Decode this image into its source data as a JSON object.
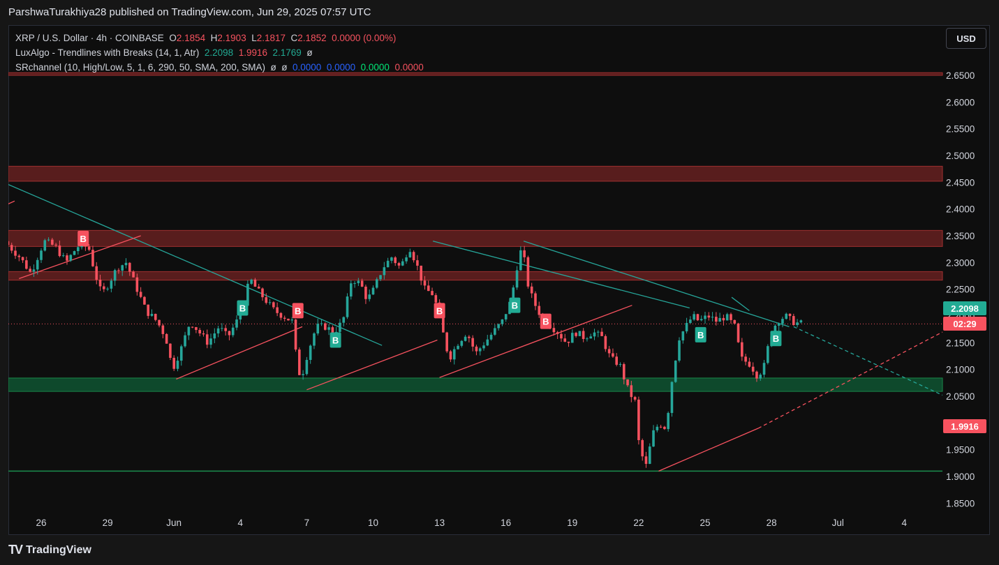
{
  "header": {
    "published_line": "ParshwaTurakhiya28 published on TradingView.com, Jun 29, 2025 07:57 UTC"
  },
  "legend": {
    "symbol_line": "XRP / U.S. Dollar · 4h · COINBASE",
    "ohlc": {
      "o_label": "O",
      "o_value": "2.1854",
      "h_label": "H",
      "h_value": "2.1903",
      "l_label": "L",
      "l_value": "2.1817",
      "c_label": "C",
      "c_value": "2.1852",
      "change": "0.0000 (0.00%)"
    },
    "luxalgo_name": "LuxAlgo - Trendlines with Breaks (14, 1, Atr)",
    "luxalgo_values": [
      "2.2098",
      "1.9916",
      "2.1769",
      "ø"
    ],
    "srchannel_name": "SRchannel (10, High/Low, 5, 1, 6, 290, 50, SMA, 200, SMA)",
    "srchannel_values": [
      "ø",
      "ø",
      "0.0000",
      "0.0000",
      "0.0000",
      "0.0000"
    ]
  },
  "toolbar": {
    "currency": "USD"
  },
  "price_tags": {
    "upper_value": "2.2098",
    "countdown": "02:29",
    "lower_value": "1.9916"
  },
  "footer": {
    "logo_icon": "tradingview-logo-icon",
    "brand": "TradingView"
  },
  "colors": {
    "up": "#26a69a",
    "down": "#f7525f",
    "teal_tag": "#22ab94",
    "resistance_zone": "#5c1e1e",
    "support_zone": "#0f4d2e",
    "frame_bg": "#0e0e0e"
  },
  "chart_data": {
    "type": "candlestick",
    "symbol": "XRP / U.S. Dollar",
    "timeframe": "4h",
    "ylim": [
      1.83,
      2.68
    ],
    "y_ticks": [
      "2.6500",
      "2.6000",
      "2.5500",
      "2.5000",
      "2.4500",
      "2.4000",
      "2.3500",
      "2.3000",
      "2.2500",
      "2.2000",
      "2.1500",
      "2.1000",
      "2.0500",
      "2.0000",
      "1.9500",
      "1.9000",
      "1.8500"
    ],
    "x_ticks": [
      "26",
      "29",
      "Jun",
      "4",
      "7",
      "10",
      "13",
      "16",
      "19",
      "22",
      "25",
      "28",
      "Jul",
      "4"
    ],
    "x_tick_days": [
      26,
      29,
      32,
      35,
      38,
      41,
      44,
      47,
      50,
      53,
      56,
      59,
      62,
      65
    ],
    "x_tick_days_note": "continuous day count starting May 1, 2025",
    "price_path": [
      [
        24.5,
        2.34
      ],
      [
        25.2,
        2.31
      ],
      [
        25.7,
        2.28
      ],
      [
        26.3,
        2.34
      ],
      [
        26.8,
        2.33
      ],
      [
        27.3,
        2.3
      ],
      [
        27.8,
        2.33
      ],
      [
        28.3,
        2.33
      ],
      [
        28.6,
        2.28
      ],
      [
        28.9,
        2.24
      ],
      [
        29.2,
        2.26
      ],
      [
        29.6,
        2.29
      ],
      [
        30.0,
        2.3
      ],
      [
        30.4,
        2.26
      ],
      [
        30.9,
        2.21
      ],
      [
        31.4,
        2.19
      ],
      [
        31.8,
        2.16
      ],
      [
        32.1,
        2.1
      ],
      [
        32.5,
        2.14
      ],
      [
        32.9,
        2.19
      ],
      [
        33.3,
        2.17
      ],
      [
        33.7,
        2.15
      ],
      [
        34.2,
        2.18
      ],
      [
        34.6,
        2.16
      ],
      [
        35.0,
        2.19
      ],
      [
        35.3,
        2.22
      ],
      [
        35.6,
        2.27
      ],
      [
        35.9,
        2.25
      ],
      [
        36.3,
        2.23
      ],
      [
        36.7,
        2.21
      ],
      [
        37.1,
        2.2
      ],
      [
        37.5,
        2.19
      ],
      [
        37.7,
        2.12
      ],
      [
        37.9,
        2.08
      ],
      [
        38.2,
        2.13
      ],
      [
        38.6,
        2.18
      ],
      [
        39.0,
        2.18
      ],
      [
        39.4,
        2.17
      ],
      [
        39.8,
        2.19
      ],
      [
        40.2,
        2.27
      ],
      [
        40.6,
        2.26
      ],
      [
        40.9,
        2.23
      ],
      [
        41.2,
        2.25
      ],
      [
        41.6,
        2.29
      ],
      [
        42.0,
        2.31
      ],
      [
        42.4,
        2.29
      ],
      [
        42.8,
        2.33
      ],
      [
        43.1,
        2.3
      ],
      [
        43.5,
        2.25
      ],
      [
        43.9,
        2.24
      ],
      [
        44.2,
        2.19
      ],
      [
        44.6,
        2.12
      ],
      [
        45.0,
        2.15
      ],
      [
        45.4,
        2.17
      ],
      [
        45.8,
        2.13
      ],
      [
        46.2,
        2.15
      ],
      [
        46.6,
        2.17
      ],
      [
        47.0,
        2.19
      ],
      [
        47.4,
        2.23
      ],
      [
        47.7,
        2.3
      ],
      [
        47.9,
        2.33
      ],
      [
        48.2,
        2.25
      ],
      [
        48.6,
        2.21
      ],
      [
        49.0,
        2.19
      ],
      [
        49.5,
        2.17
      ],
      [
        49.9,
        2.15
      ],
      [
        50.3,
        2.17
      ],
      [
        50.7,
        2.16
      ],
      [
        51.1,
        2.17
      ],
      [
        51.5,
        2.16
      ],
      [
        51.9,
        2.12
      ],
      [
        52.3,
        2.11
      ],
      [
        52.7,
        2.06
      ],
      [
        53.0,
        2.04
      ],
      [
        53.2,
        1.95
      ],
      [
        53.5,
        1.92
      ],
      [
        53.8,
        1.98
      ],
      [
        54.1,
        2.0
      ],
      [
        54.4,
        1.99
      ],
      [
        54.7,
        2.09
      ],
      [
        55.0,
        2.16
      ],
      [
        55.3,
        2.18
      ],
      [
        55.6,
        2.2
      ],
      [
        55.9,
        2.19
      ],
      [
        56.3,
        2.2
      ],
      [
        56.7,
        2.19
      ],
      [
        57.1,
        2.2
      ],
      [
        57.5,
        2.18
      ],
      [
        57.8,
        2.12
      ],
      [
        58.2,
        2.11
      ],
      [
        58.5,
        2.09
      ],
      [
        58.8,
        2.1
      ],
      [
        59.1,
        2.16
      ],
      [
        59.4,
        2.19
      ],
      [
        59.8,
        2.2
      ],
      [
        60.1,
        2.19
      ],
      [
        60.4,
        2.186
      ]
    ],
    "zones": [
      {
        "kind": "resistance",
        "y0": 2.655,
        "y1": 2.65
      },
      {
        "kind": "resistance",
        "y0": 2.48,
        "y1": 2.452
      },
      {
        "kind": "resistance",
        "y0": 2.36,
        "y1": 2.33
      },
      {
        "kind": "resistance",
        "y0": 2.283,
        "y1": 2.267
      },
      {
        "kind": "support",
        "y0": 2.084,
        "y1": 2.059
      }
    ],
    "horizontal_lines": [
      {
        "y": 1.91,
        "color": "#1b8f4e"
      }
    ],
    "trendlines": [
      {
        "color": "#26a69a",
        "x0": 24.0,
        "y0": 2.455,
        "x1": 41.4,
        "y1": 2.145,
        "dashed": false
      },
      {
        "color": "#26a69a",
        "x0": 43.7,
        "y0": 2.34,
        "x1": 55.3,
        "y1": 2.215,
        "dashed": false
      },
      {
        "color": "#26a69a",
        "x0": 47.8,
        "y0": 2.34,
        "x1": 59.8,
        "y1": 2.18,
        "dashed": false
      },
      {
        "color": "#26a69a",
        "x0": 57.2,
        "y0": 2.235,
        "x1": 58.0,
        "y1": 2.21,
        "dashed": false
      },
      {
        "color": "#26a69a",
        "x0": 60.0,
        "y0": 2.18,
        "x1": 68.5,
        "y1": 2.052,
        "dashed": true
      },
      {
        "color": "#f7525f",
        "x0": 24.0,
        "y0": 2.4,
        "x1": 24.8,
        "y1": 2.415,
        "dashed": false
      },
      {
        "color": "#f7525f",
        "x0": 25.0,
        "y0": 2.27,
        "x1": 30.5,
        "y1": 2.35,
        "dashed": false
      },
      {
        "color": "#f7525f",
        "x0": 32.1,
        "y0": 2.082,
        "x1": 37.8,
        "y1": 2.18,
        "dashed": false
      },
      {
        "color": "#f7525f",
        "x0": 38.0,
        "y0": 2.062,
        "x1": 43.9,
        "y1": 2.155,
        "dashed": false
      },
      {
        "color": "#f7525f",
        "x0": 44.0,
        "y0": 2.085,
        "x1": 52.7,
        "y1": 2.22,
        "dashed": false
      },
      {
        "color": "#f7525f",
        "x0": 53.9,
        "y0": 1.91,
        "x1": 58.4,
        "y1": 1.99,
        "dashed": false
      },
      {
        "color": "#f7525f",
        "x0": 58.4,
        "y0": 1.99,
        "x1": 68.5,
        "y1": 2.17,
        "dashed": true
      }
    ],
    "signals": [
      {
        "label": "B",
        "kind": "break-down",
        "x": 27.9,
        "y": 2.345
      },
      {
        "label": "B",
        "kind": "break-up",
        "x": 35.1,
        "y": 2.215
      },
      {
        "label": "B",
        "kind": "break-down",
        "x": 37.6,
        "y": 2.21
      },
      {
        "label": "B",
        "kind": "break-up",
        "x": 39.3,
        "y": 2.155
      },
      {
        "label": "B",
        "kind": "break-down",
        "x": 44.0,
        "y": 2.21
      },
      {
        "label": "B",
        "kind": "break-up",
        "x": 47.4,
        "y": 2.22
      },
      {
        "label": "B",
        "kind": "break-down",
        "x": 48.8,
        "y": 2.19
      },
      {
        "label": "B",
        "kind": "break-up",
        "x": 55.8,
        "y": 2.165
      },
      {
        "label": "B",
        "kind": "break-up",
        "x": 59.2,
        "y": 2.158
      }
    ],
    "last_price_line": 2.1852,
    "grid": false,
    "legend_position": "top-left"
  }
}
